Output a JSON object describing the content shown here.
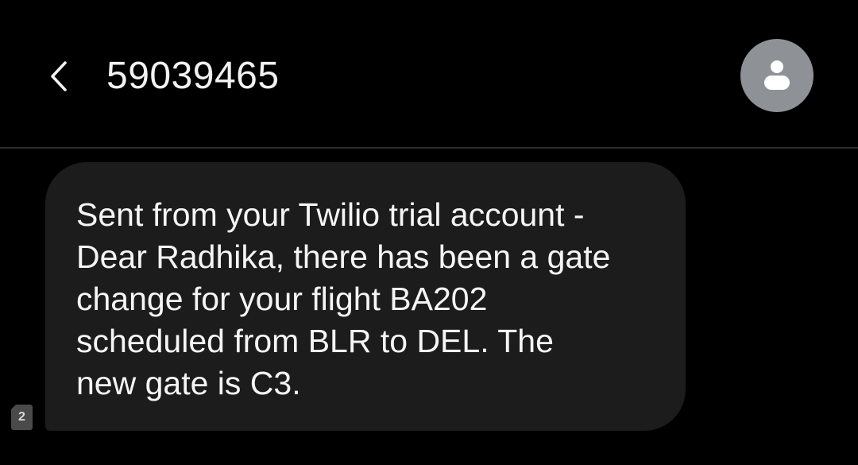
{
  "header": {
    "contact_number": "59039465",
    "back_icon": "chevron-left-icon",
    "avatar_icon": "person-icon",
    "avatar_color": "#8e9297"
  },
  "message": {
    "text_lines": [
      "Sent from your Twilio trial account -",
      "Dear Radhika, there has been a gate",
      "change for your flight BA202",
      "scheduled from BLR to DEL. The",
      "new gate is C3."
    ],
    "sim_slot": "2",
    "bubble_color": "#1c1c1c"
  },
  "colors": {
    "background": "#000000",
    "text": "#f5f5f5",
    "divider": "#2b2b2b"
  }
}
